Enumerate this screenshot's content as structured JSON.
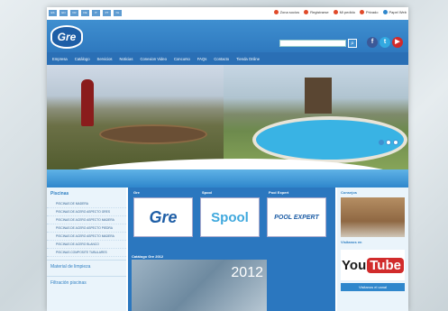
{
  "top": {
    "languages": [
      "ES",
      "EN",
      "FR",
      "DE",
      "IT",
      "PT",
      "NL"
    ],
    "links": [
      {
        "label": "Zona socios",
        "icon": "user-icon"
      },
      {
        "label": "Registrarse",
        "icon": "register-icon"
      },
      {
        "label": "Mi pedido",
        "icon": "cart-icon"
      },
      {
        "label": "Privado",
        "icon": "lock-icon"
      },
      {
        "label": "Papel Web",
        "icon": "web-icon"
      }
    ]
  },
  "header": {
    "logo_text": "Gre",
    "search_button": "⌕",
    "socials": [
      {
        "label": "f",
        "color": "#3b5998"
      },
      {
        "label": "t",
        "color": "#33a9e0"
      },
      {
        "label": "▶",
        "color": "#d12b2b"
      }
    ]
  },
  "nav": {
    "items": [
      "Empresa",
      "Catálogo",
      "Servicios",
      "Noticias",
      "Conexion Video",
      "Concurso",
      "FAQs",
      "Contacto",
      "Tienda Online"
    ]
  },
  "sidebar": {
    "heading": "Piscinas",
    "items": [
      "PISCINAS DE MADERA",
      "PISCINAS DE ACERO ASPECTO GRES",
      "PISCINAS DE ACERO ASPECTO MADERA",
      "PISCINAS DE ACERO ASPECTO PIEDRA",
      "PISCINAS DE ACERO ASPECTO MADERA",
      "PISCINAS DE ACERO BLANCO",
      "PISCINAS COMPOSITE TUBULARES"
    ],
    "section2": "Material de limpieza",
    "section3": "Filtración piscinas"
  },
  "main": {
    "col1": "Gre",
    "col2": "Spool",
    "col3": "Pool Expert",
    "brand1": "Gre",
    "brand2": "Spool",
    "brand3": "POOL EXPERT",
    "catalog": "Catálogo Gre 2012",
    "year": "2012"
  },
  "right": {
    "heading": "Consejos",
    "youtube_heading": "Visitanos en",
    "you": "You",
    "tube": "Tube",
    "link": "Visitanos el canal"
  }
}
